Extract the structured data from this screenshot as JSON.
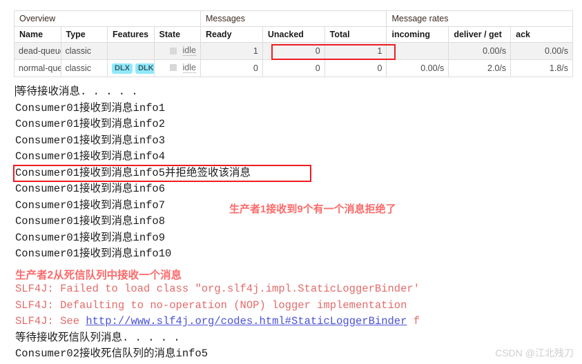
{
  "table": {
    "group_headers": [
      {
        "label": "Overview",
        "span": 4
      },
      {
        "label": "Messages",
        "span": 3
      },
      {
        "label": "Message rates",
        "span": 3
      }
    ],
    "columns": [
      "Name",
      "Type",
      "Features",
      "State",
      "Ready",
      "Unacked",
      "Total",
      "incoming",
      "deliver / get",
      "ack"
    ],
    "rows": [
      {
        "name": "dead-queue",
        "type": "classic",
        "features": [],
        "state": "idle",
        "ready": "1",
        "unacked": "0",
        "total": "1",
        "incoming": "",
        "deliver_get": "0.00/s",
        "ack": "0.00/s"
      },
      {
        "name": "normal-queue",
        "type": "classic",
        "features": [
          "DLX",
          "DLK"
        ],
        "state": "idle",
        "ready": "0",
        "unacked": "0",
        "total": "0",
        "incoming": "0.00/s",
        "deliver_get": "2.0/s",
        "ack": "1.8/s"
      }
    ],
    "highlight_color": "#ee1c23"
  },
  "console": {
    "lines": [
      {
        "text": "等待接收消息. . . . .",
        "style": "normal",
        "caret": true
      },
      {
        "text": "Consumer01接收到消息info1",
        "style": "normal"
      },
      {
        "text": "Consumer01接收到消息info2",
        "style": "normal"
      },
      {
        "text": "Consumer01接收到消息info3",
        "style": "normal"
      },
      {
        "text": "Consumer01接收到消息info4",
        "style": "normal"
      },
      {
        "text": "Consumer01接收到消息info5并拒绝签收该消息",
        "style": "normal",
        "boxed": true
      },
      {
        "text": "Consumer01接收到消息info6",
        "style": "normal"
      },
      {
        "text": "Consumer01接收到消息info7",
        "style": "normal"
      },
      {
        "text": "Consumer01接收到消息info8",
        "style": "normal"
      },
      {
        "text": "Consumer01接收到消息info9",
        "style": "normal"
      },
      {
        "text": "Consumer01接收到消息info10",
        "style": "normal"
      },
      {
        "text": "",
        "style": "normal"
      },
      {
        "text": "",
        "style": "spacer"
      },
      {
        "text": "SLF4J: Failed to load class \"org.slf4j.impl.StaticLoggerBinder'",
        "style": "error"
      },
      {
        "text": "SLF4J: Defaulting to no-operation (NOP) logger implementation",
        "style": "error"
      },
      {
        "prefix": "SLF4J: See ",
        "link": "http://www.slf4j.org/codes.html#StaticLoggerBinder",
        "suffix": " f",
        "style": "error-link"
      },
      {
        "text": "等待接收死信队列消息. . . . .",
        "style": "normal"
      },
      {
        "text": "Consumer02接收死信队列的消息info5",
        "style": "normal"
      }
    ]
  },
  "annotations": [
    {
      "id": "annot-1",
      "text": "生产者1接收到9个有一个消息拒绝了",
      "color": "#fb6a6a"
    },
    {
      "id": "annot-2",
      "text": "生产者2从死信队列中接收一个消息",
      "color": "#fb6a6a"
    }
  ],
  "watermark": {
    "text": "CSDN @江北残刀"
  }
}
